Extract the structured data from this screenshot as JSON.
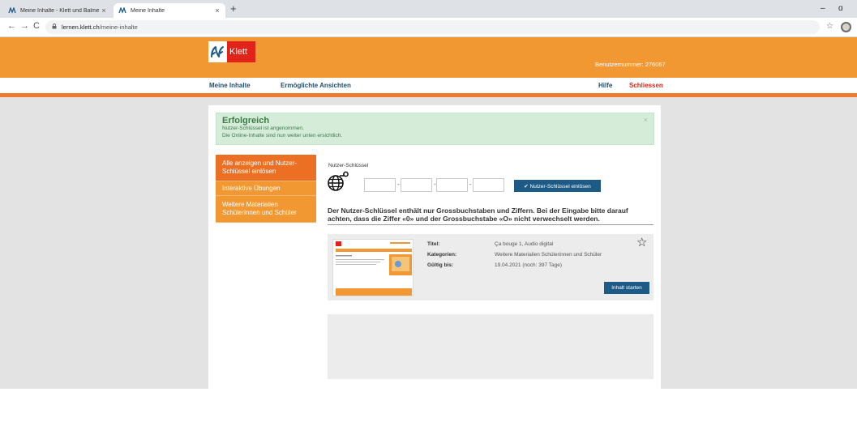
{
  "browser": {
    "tabs": [
      {
        "title": "Meine Inhalte - Klett und Balmer",
        "close": "×"
      },
      {
        "title": "Meine Inhalte",
        "close": "×"
      }
    ],
    "new_tab": "+",
    "window_controls": {
      "minimize": "–",
      "restore": "ɑ"
    },
    "nav": {
      "back": "←",
      "forward": "→",
      "reload": "C"
    },
    "url": {
      "host": "lernen.klett.ch",
      "path": "/meine-inhalte"
    },
    "bookmark_icon": "☆"
  },
  "header": {
    "logo_text": "Klett",
    "user_number": "Benutzernummer: 276067"
  },
  "nav": {
    "my_content": "Meine Inhalte",
    "enabled_views": "Ermöglichte Ansichten",
    "help": "Hilfe",
    "close": "Schliessen"
  },
  "alert": {
    "title": "Erfolgreich",
    "line1": "Nutzer-Schlüssel ist angenommen.",
    "line2": "Die Online-Inhalte sind nun weiter unten ersichtlich.",
    "close": "×"
  },
  "sidebar": {
    "items": [
      {
        "label": "Alle anzeigen und Nutzer-Schlüssel einlösen"
      },
      {
        "label": "Interaktive Übungen"
      },
      {
        "label": "Weitere Materialien Schülerinnen und Schüler"
      }
    ]
  },
  "key_form": {
    "label": "Nutzer-Schlüssel",
    "separator": "-",
    "redeem_button": "✔ Nutzer-Schlüssel einlösen"
  },
  "hint": "Der Nutzer-Schlüssel enthält nur Grossbuchstaben und Ziffern. Bei der Eingabe bitte darauf achten, dass die Ziffer «0» und der Grossbuchstabe «O» nicht verwechselt werden.",
  "product": {
    "title_label": "Titel:",
    "title_value": "Ça bouge 1, Audio digital",
    "categories_label": "Kategorien:",
    "categories_value": "Weitere Materialien Schülerinnen und Schüler",
    "valid_label": "Gültig bis:",
    "valid_value": "19.04.2021 (noch: 397 Tage)",
    "start_button": "Inhalt starten",
    "favorite_icon": "☆"
  },
  "colors": {
    "orange": "#f29833",
    "orange_dark": "#ec7023",
    "klett_red": "#e2231a",
    "button_blue": "#1d5a86",
    "nav_blue": "#1f4e6e",
    "success_bg": "#d5ecd9"
  }
}
